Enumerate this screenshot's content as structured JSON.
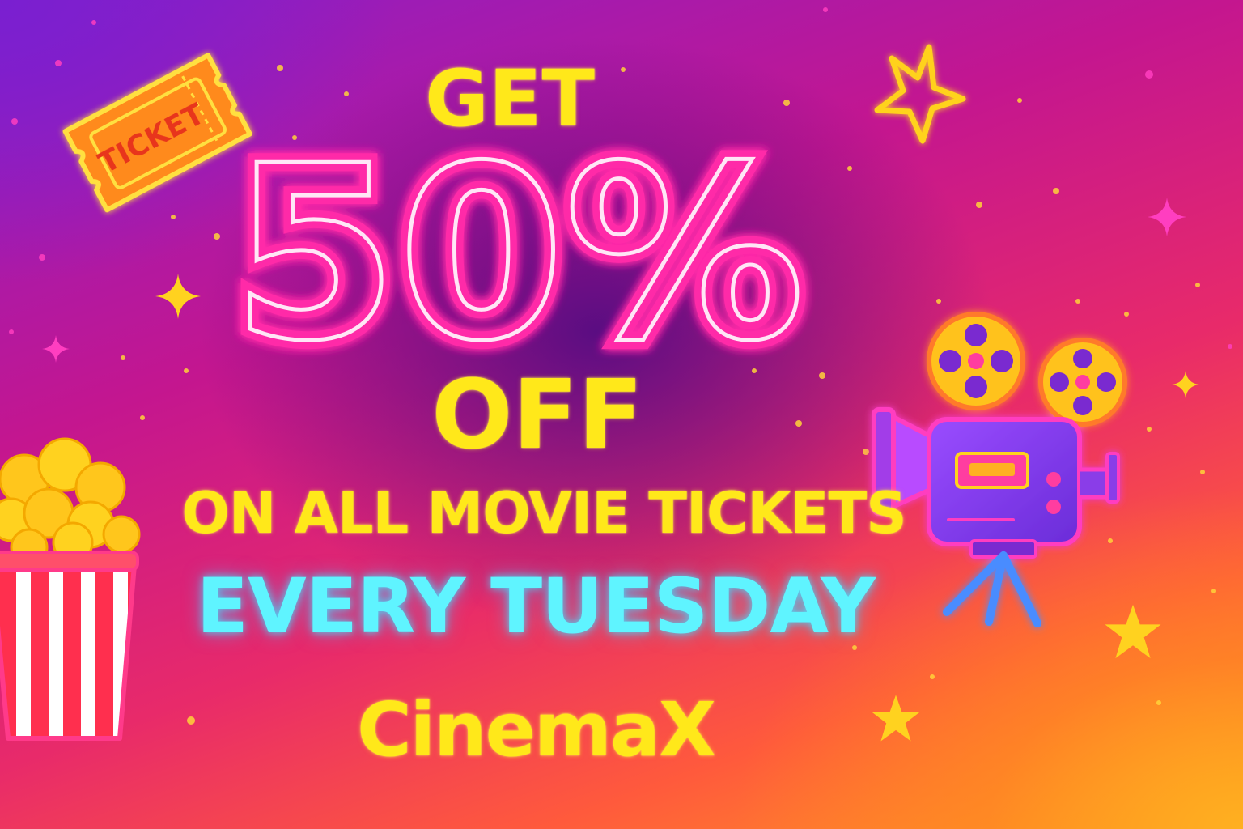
{
  "promo": {
    "get": "GET",
    "discount": "50%",
    "off": "OFF",
    "subtitle": "ON ALL MOVIE TICKETS",
    "day": "EVERY TUESDAY",
    "brand": "CinemaX"
  },
  "ticket": {
    "label": "TICKET"
  },
  "colors": {
    "primary_text": "#ffe81a",
    "neon_pink": "#ff2aa8",
    "neon_cyan": "#5ff4ff",
    "background_top": "#8a1fc8",
    "background_bottom": "#ffa020"
  },
  "icons": [
    "ticket-icon",
    "star-icon",
    "sparkle-icon",
    "popcorn-icon",
    "movie-camera-icon"
  ]
}
